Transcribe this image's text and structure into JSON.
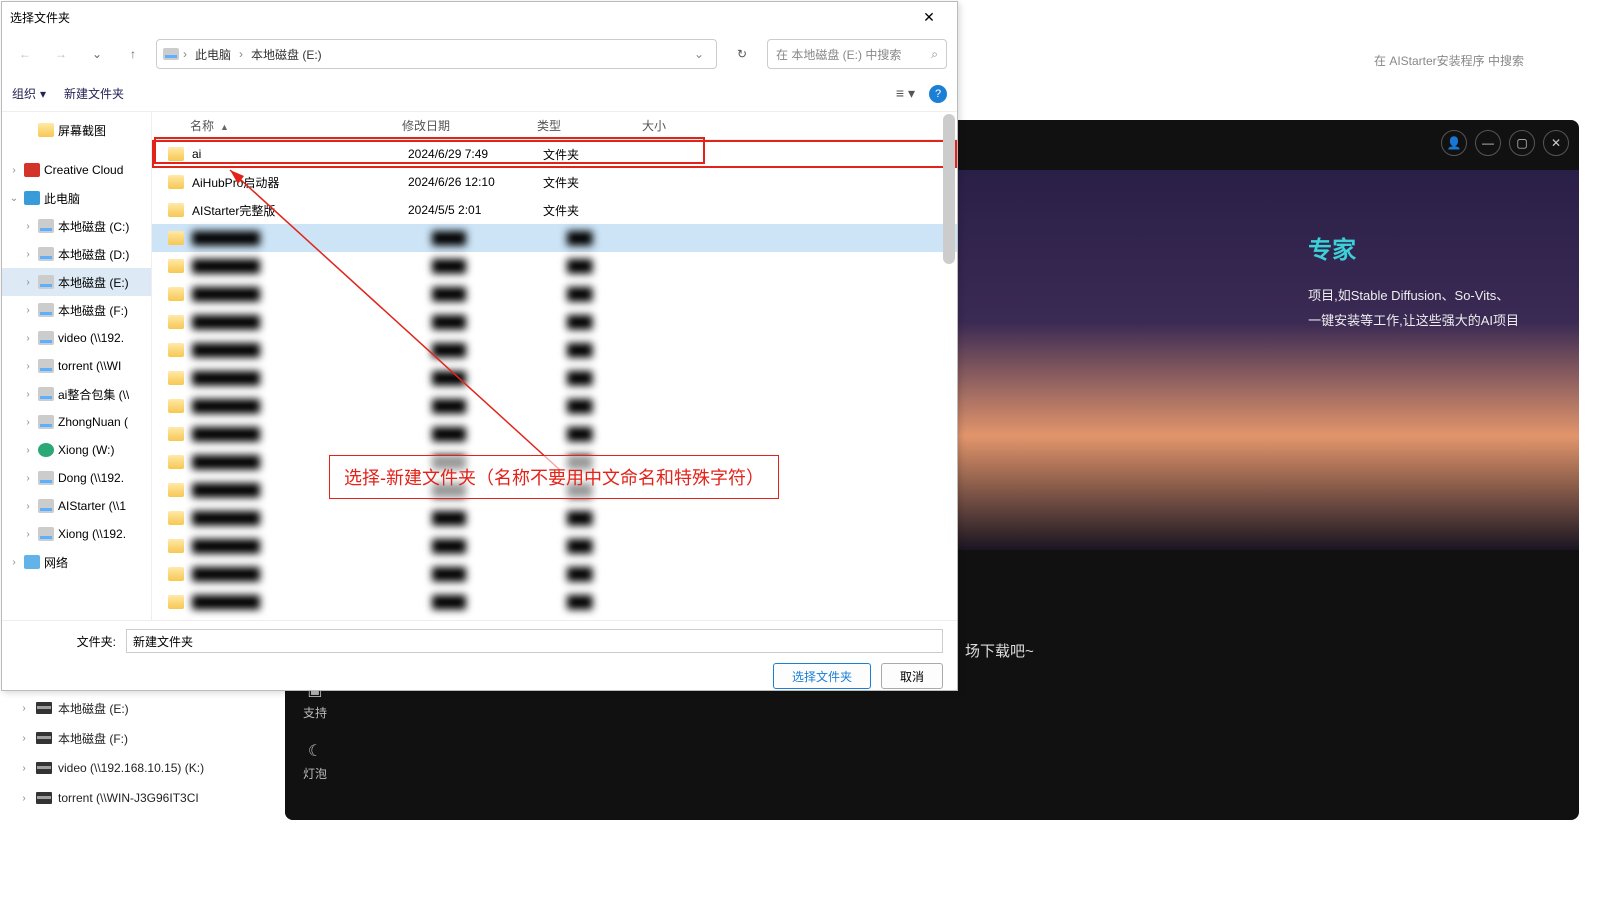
{
  "dialog": {
    "title": "选择文件夹",
    "breadcrumb": {
      "seg1": "此电脑",
      "seg2": "本地磁盘 (E:)"
    },
    "search_placeholder": "在 本地磁盘 (E:) 中搜索",
    "toolbar": {
      "organize": "组织",
      "new_folder": "新建文件夹"
    },
    "columns": {
      "name": "名称",
      "date": "修改日期",
      "type": "类型",
      "size": "大小"
    },
    "rows": [
      {
        "name": "ai",
        "date": "2024/6/29 7:49",
        "type": "文件夹",
        "highlight": true
      },
      {
        "name": "AiHubPro启动器",
        "date": "2024/6/26 12:10",
        "type": "文件夹"
      },
      {
        "name": "AIStarter完整版",
        "date": "2024/5/5 2:01",
        "type": "文件夹"
      },
      {
        "blur": true,
        "sel": true
      },
      {
        "blur": true
      },
      {
        "blur": true
      },
      {
        "blur": true
      },
      {
        "blur": true
      },
      {
        "blur": true
      },
      {
        "blur": true
      },
      {
        "blur": true
      },
      {
        "blur": true
      },
      {
        "blur": true
      },
      {
        "blur": true
      },
      {
        "blur": true
      },
      {
        "blur": true
      },
      {
        "blur": true
      }
    ],
    "tree": [
      {
        "icon": "folder",
        "label": "屏幕截图",
        "indent": 1
      },
      {
        "gap": true
      },
      {
        "icon": "cc",
        "label": "Creative Cloud",
        "chev": "›",
        "indent": 0
      },
      {
        "icon": "pc",
        "label": "此电脑",
        "chev": "⌄",
        "indent": 0
      },
      {
        "icon": "drive",
        "label": "本地磁盘 (C:)",
        "chev": "›",
        "indent": 1
      },
      {
        "icon": "drive",
        "label": "本地磁盘 (D:)",
        "chev": "›",
        "indent": 1
      },
      {
        "icon": "drive",
        "label": "本地磁盘 (E:)",
        "chev": "›",
        "indent": 1,
        "sel": true
      },
      {
        "icon": "drive",
        "label": "本地磁盘 (F:)",
        "chev": "›",
        "indent": 1
      },
      {
        "icon": "drive",
        "label": "video (\\\\192.",
        "chev": "›",
        "indent": 1
      },
      {
        "icon": "drive",
        "label": "torrent (\\\\WI",
        "chev": "›",
        "indent": 1
      },
      {
        "icon": "drive",
        "label": "ai整合包集 (\\\\",
        "chev": "›",
        "indent": 1
      },
      {
        "icon": "drive",
        "label": "ZhongNuan (",
        "chev": "›",
        "indent": 1
      },
      {
        "icon": "xiong",
        "label": "Xiong (W:)",
        "chev": "›",
        "indent": 1
      },
      {
        "icon": "drive",
        "label": "Dong (\\\\192.",
        "chev": "›",
        "indent": 1
      },
      {
        "icon": "drive",
        "label": "AIStarter (\\\\1",
        "chev": "›",
        "indent": 1
      },
      {
        "icon": "drive",
        "label": "Xiong (\\\\192.",
        "chev": "›",
        "indent": 1
      },
      {
        "icon": "net",
        "label": "网络",
        "chev": "›",
        "indent": 0
      }
    ],
    "footer": {
      "label": "文件夹:",
      "value": "新建文件夹",
      "select_btn": "选择文件夹",
      "cancel_btn": "取消"
    }
  },
  "annotation": {
    "text": "选择-新建文件夹（名称不要用中文命名和特殊字符）"
  },
  "background": {
    "search_placeholder": "在 AIStarter安装程序 中搜索",
    "hero_title": "专家",
    "hero_line1": "项目,如Stable Diffusion、So-Vits、",
    "hero_line2": "一键安装等工作,让这些强大的AI项目",
    "download_hint": "场下载吧~",
    "side": {
      "support": "支持",
      "lamp": "灯泡"
    },
    "under_tree": [
      {
        "label": "本地磁盘 (E:)"
      },
      {
        "label": "本地磁盘 (F:)"
      },
      {
        "label": "video (\\\\192.168.10.15) (K:)"
      },
      {
        "label": "torrent (\\\\WIN-J3G96IT3CI"
      }
    ]
  }
}
